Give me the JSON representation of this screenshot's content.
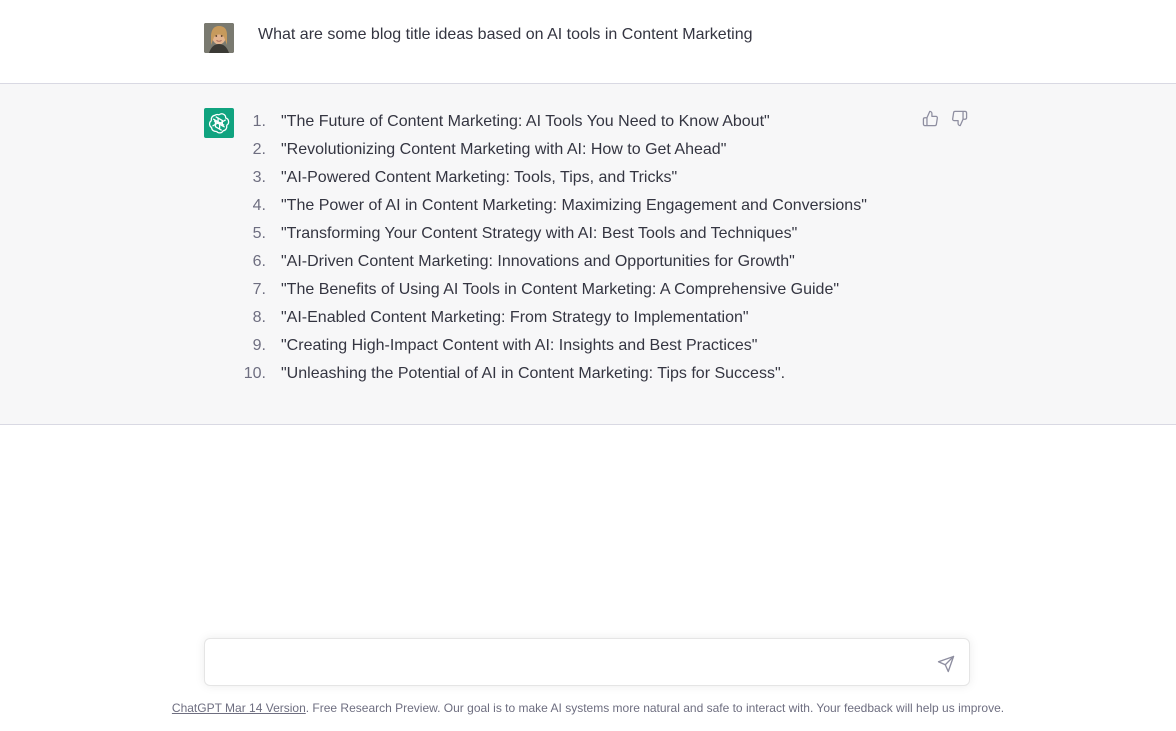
{
  "user_message": {
    "text": "What are some blog title ideas based on AI tools in Content Marketing"
  },
  "answer": {
    "items": [
      {
        "num": "1.",
        "text": "\"The Future of Content Marketing: AI Tools You Need to Know About\""
      },
      {
        "num": "2.",
        "text": "\"Revolutionizing Content Marketing with AI: How to Get Ahead\""
      },
      {
        "num": "3.",
        "text": "\"AI-Powered Content Marketing: Tools, Tips, and Tricks\""
      },
      {
        "num": "4.",
        "text": "\"The Power of AI in Content Marketing: Maximizing Engagement and Conversions\""
      },
      {
        "num": "5.",
        "text": "\"Transforming Your Content Strategy with AI: Best Tools and Techniques\""
      },
      {
        "num": "6.",
        "text": "\"AI-Driven Content Marketing: Innovations and Opportunities for Growth\""
      },
      {
        "num": "7.",
        "text": "\"The Benefits of Using AI Tools in Content Marketing: A Comprehensive Guide\""
      },
      {
        "num": "8.",
        "text": "\"AI-Enabled Content Marketing: From Strategy to Implementation\""
      },
      {
        "num": "9.",
        "text": "\"Creating High-Impact Content with AI: Insights and Best Practices\""
      },
      {
        "num": "10.",
        "text": "\"Unleashing the Potential of AI in Content Marketing: Tips for Success\"."
      }
    ]
  },
  "composer": {
    "value": "",
    "placeholder": ""
  },
  "footer": {
    "link_text": "ChatGPT Mar 14 Version",
    "text": ". Free Research Preview. Our goal is to make AI systems more natural and safe to interact with. Your feedback will help us improve."
  },
  "icons": {
    "user_avatar": "user-photo",
    "assistant_avatar": "openai-logo-icon",
    "thumbs_up": "thumbs-up-icon",
    "thumbs_down": "thumbs-down-icon",
    "send": "send-icon"
  },
  "colors": {
    "assistant_accent": "#10a37f",
    "assistant_bg": "#f7f7f8",
    "text": "#343541",
    "muted": "#6e6e80"
  }
}
